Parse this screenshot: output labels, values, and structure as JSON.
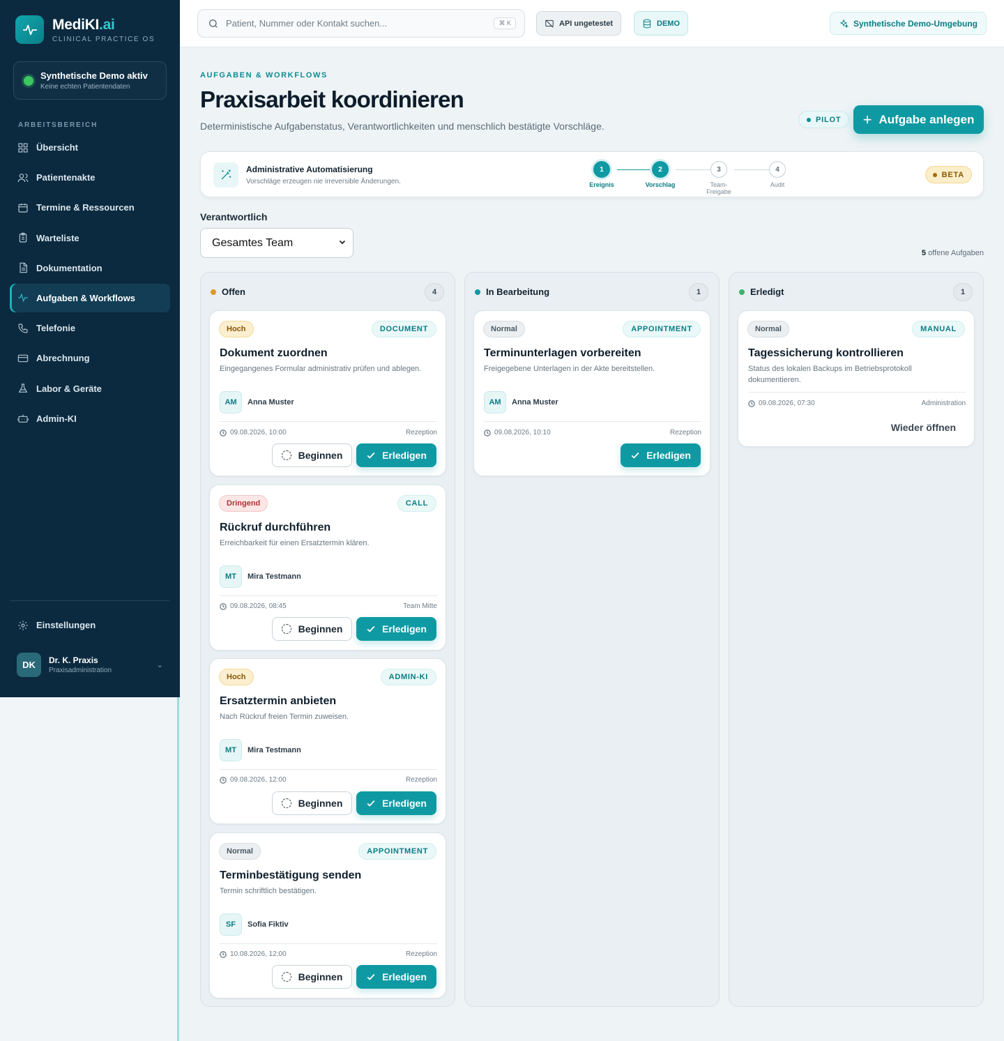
{
  "app": {
    "name": "MediKI",
    "name_suffix": ".ai",
    "subtitle": "CLINICAL PRACTICE OS"
  },
  "demo_status": {
    "title": "Synthetische Demo aktiv",
    "subtitle": "Keine echten Patientendaten"
  },
  "sidebar": {
    "section_label": "ARBEITSBEREICH",
    "items": [
      {
        "label": "Übersicht",
        "icon": "grid-icon"
      },
      {
        "label": "Patientenakte",
        "icon": "users-icon"
      },
      {
        "label": "Termine & Ressourcen",
        "icon": "calendar-icon"
      },
      {
        "label": "Warteliste",
        "icon": "clipboard-icon"
      },
      {
        "label": "Dokumentation",
        "icon": "document-icon"
      },
      {
        "label": "Aufgaben & Workflows",
        "icon": "activity-icon",
        "active": true
      },
      {
        "label": "Telefonie",
        "icon": "phone-icon"
      },
      {
        "label": "Abrechnung",
        "icon": "credit-card-icon"
      },
      {
        "label": "Labor & Geräte",
        "icon": "flask-icon"
      },
      {
        "label": "Admin-KI",
        "icon": "robot-icon"
      }
    ],
    "settings_label": "Einstellungen",
    "user": {
      "initials": "DK",
      "name": "Dr. K. Praxis",
      "role": "Praxisadministration"
    }
  },
  "topbar": {
    "search_placeholder": "Patient, Nummer oder Kontakt suchen...",
    "search_shortcut": "⌘ K",
    "api_status": "API ungetestet",
    "mode_badge": "DEMO",
    "environment": "Synthetische Demo-Umgebung"
  },
  "header": {
    "eyebrow": "AUFGABEN & WORKFLOWS",
    "title": "Praxisarbeit koordinieren",
    "description": "Deterministische Aufgabenstatus, Verantwortlichkeiten und menschlich bestätigte Vorschläge.",
    "pilot_badge": "PILOT",
    "add_button": "Aufgabe anlegen"
  },
  "automation": {
    "title": "Administrative Automatisierung",
    "subtitle": "Vorschläge erzeugen nie irreversible Änderungen.",
    "beta_badge": "BETA",
    "steps": [
      {
        "number": "1",
        "label": "Ereignis",
        "done": true
      },
      {
        "number": "2",
        "label": "Vorschlag",
        "done": true
      },
      {
        "number": "3",
        "label": "Team-Freigabe",
        "done": false
      },
      {
        "number": "4",
        "label": "Audit",
        "done": false
      }
    ]
  },
  "filter": {
    "label": "Verantwortlich",
    "selected": "Gesamtes Team",
    "open_count": "5",
    "open_count_suffix": "offene Aufgaben"
  },
  "buttons": {
    "start": "Beginnen",
    "done": "Erledigen",
    "reopen": "Wieder öffnen"
  },
  "columns": [
    {
      "name": "Offen",
      "count": "4",
      "color": "#e0962a",
      "cards": [
        {
          "priority": "Hoch",
          "priority_class": "hoch",
          "kind": "DOCUMENT",
          "title": "Dokument zuordnen",
          "description": "Eingegangenes Formular administrativ prüfen und ablegen.",
          "initials": "AM",
          "assignee": "Anna Muster",
          "datetime": "09.08.2026, 10:00",
          "team": "Rezeption"
        },
        {
          "priority": "Dringend",
          "priority_class": "dringend",
          "kind": "CALL",
          "title": "Rückruf durchführen",
          "description": "Erreichbarkeit für einen Ersatztermin klären.",
          "initials": "MT",
          "assignee": "Mira Testmann",
          "datetime": "09.08.2026, 08:45",
          "team": "Team Mitte"
        },
        {
          "priority": "Hoch",
          "priority_class": "hoch",
          "kind": "ADMIN-KI",
          "title": "Ersatztermin anbieten",
          "description": "Nach Rückruf freien Termin zuweisen.",
          "initials": "MT",
          "assignee": "Mira Testmann",
          "datetime": "09.08.2026, 12:00",
          "team": "Rezeption"
        },
        {
          "priority": "Normal",
          "priority_class": "normal",
          "kind": "APPOINTMENT",
          "title": "Terminbestätigung senden",
          "description": "Termin schriftlich bestätigen.",
          "initials": "SF",
          "assignee": "Sofia Fiktiv",
          "datetime": "10.08.2026, 12:00",
          "team": "Rezeption"
        }
      ]
    },
    {
      "name": "In Bearbeitung",
      "count": "1",
      "color": "#0f9aa3",
      "cards": [
        {
          "priority": "Normal",
          "priority_class": "normal",
          "kind": "APPOINTMENT",
          "title": "Terminunterlagen vorbereiten",
          "description": "Freigegebene Unterlagen in der Akte bereitstellen.",
          "initials": "AM",
          "assignee": "Anna Muster",
          "datetime": "09.08.2026, 10:10",
          "team": "Rezeption"
        }
      ]
    },
    {
      "name": "Erledigt",
      "count": "1",
      "color": "#3ab46a",
      "cards": [
        {
          "priority": "Normal",
          "priority_class": "normal",
          "kind": "MANUAL",
          "title": "Tagessicherung kontrollieren",
          "description": "Status des lokalen Backups im Betriebsprotokoll dokumentieren.",
          "datetime": "09.08.2026, 07:30",
          "team": "Administration"
        }
      ]
    }
  ]
}
